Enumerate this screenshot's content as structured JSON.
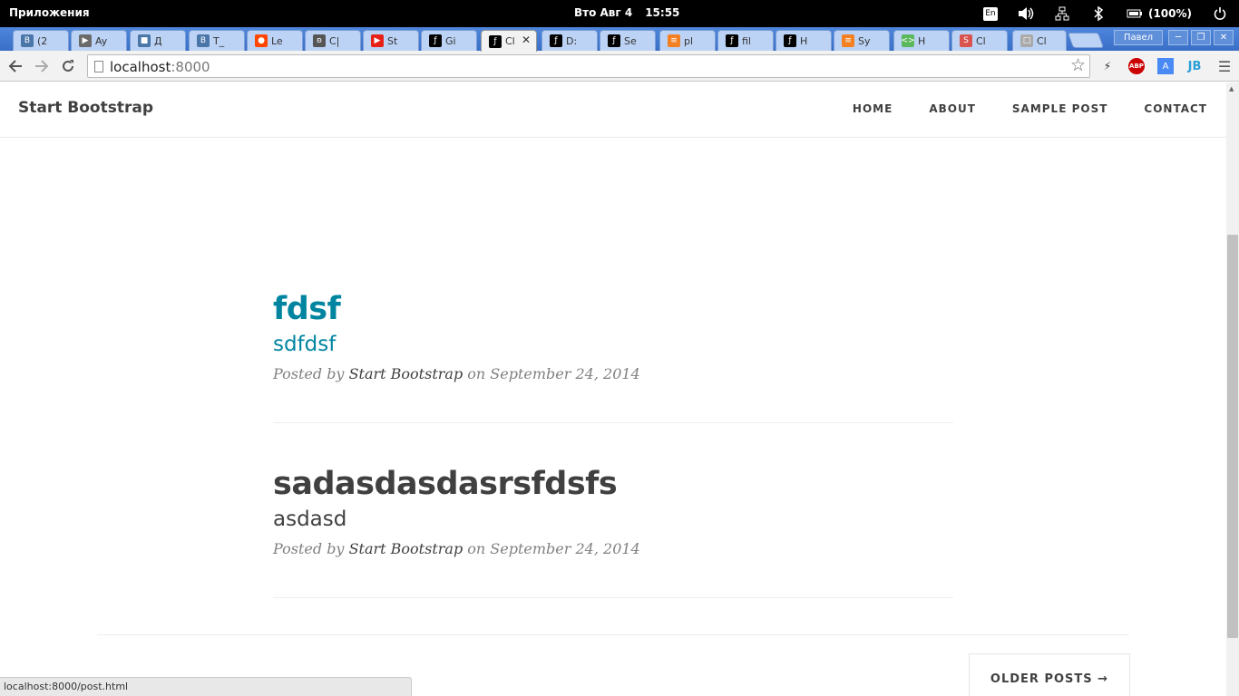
{
  "system": {
    "apps_label": "Приложения",
    "day": "Вто Авг  4",
    "time": "15:55",
    "lang": "En",
    "battery": "(100%)"
  },
  "tabs": [
    {
      "label": "(2",
      "fav": "vk-icon",
      "color": "#4a76a8",
      "glyph": "В"
    },
    {
      "label": "Ay",
      "fav": "play-icon",
      "color": "#6a6a6a",
      "glyph": "▶"
    },
    {
      "label": "Д",
      "fav": "chat-icon",
      "color": "#4a76a8",
      "glyph": "■"
    },
    {
      "label": "T_",
      "fav": "vk-icon",
      "color": "#4a76a8",
      "glyph": "В"
    },
    {
      "label": "Le",
      "fav": "reddit-icon",
      "color": "#ff4500",
      "glyph": "●"
    },
    {
      "label": "C|",
      "fav": "codeigniter-icon",
      "color": "#555",
      "glyph": "ʚ"
    },
    {
      "label": "St",
      "fav": "youtube-icon",
      "color": "#e62117",
      "glyph": "▶"
    },
    {
      "label": "Gi",
      "fav": "symfony-icon",
      "color": "#000",
      "glyph": "ƒ"
    },
    {
      "label": "Cl",
      "fav": "symfony-icon",
      "color": "#000",
      "glyph": "ƒ"
    },
    {
      "label": "D:",
      "fav": "symfony-icon",
      "color": "#000",
      "glyph": "ƒ"
    },
    {
      "label": "Se",
      "fav": "symfony-icon",
      "color": "#000",
      "glyph": "ƒ"
    },
    {
      "label": "pl",
      "fav": "stackoverflow-icon",
      "color": "#f48024",
      "glyph": "≡"
    },
    {
      "label": "fil",
      "fav": "symfony-icon",
      "color": "#000",
      "glyph": "ƒ"
    },
    {
      "label": "H",
      "fav": "symfony-icon",
      "color": "#000",
      "glyph": "ƒ"
    },
    {
      "label": "Sy",
      "fav": "stackoverflow-icon",
      "color": "#f48024",
      "glyph": "≡"
    },
    {
      "label": "H",
      "fav": "html-icon",
      "color": "#5cb85c",
      "glyph": "<>"
    },
    {
      "label": "Cl",
      "fav": "s-icon",
      "color": "#d9534f",
      "glyph": "S"
    },
    {
      "label": "Cl",
      "fav": "page-icon",
      "color": "#aaa",
      "glyph": "□"
    }
  ],
  "window": {
    "user": "Павел"
  },
  "browser": {
    "url_host": "localhost",
    "url_port": ":8000"
  },
  "site": {
    "brand": "Start Bootstrap",
    "nav": [
      "HOME",
      "ABOUT",
      "SAMPLE POST",
      "CONTACT"
    ],
    "posts": [
      {
        "title": "fdsf",
        "subtitle": "sdfdsf",
        "meta_prefix": "Posted by ",
        "author": "Start Bootstrap",
        "meta_mid": " on ",
        "date": "September 24, 2014"
      },
      {
        "title": "sadasdasdasrsfdsfs",
        "subtitle": "asdasd",
        "meta_prefix": "Posted by ",
        "author": "Start Bootstrap",
        "meta_mid": " on ",
        "date": "September 24, 2014"
      }
    ],
    "older": "OLDER POSTS →"
  },
  "status_url": "localhost:8000/post.html"
}
